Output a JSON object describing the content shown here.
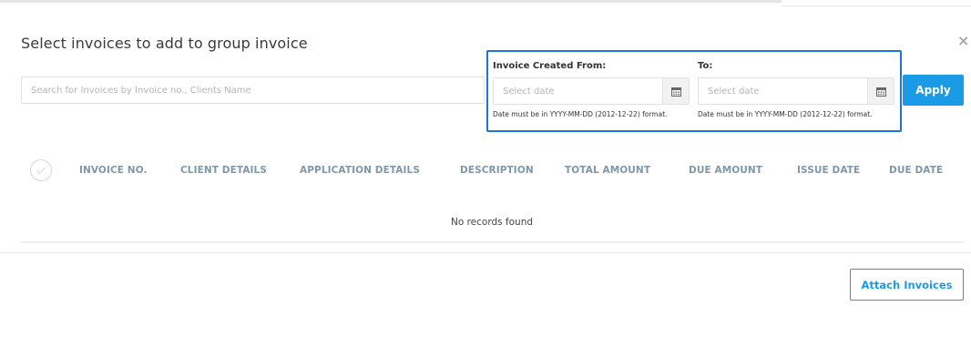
{
  "modal": {
    "title": "Select invoices to add to group invoice",
    "close_symbol": "×"
  },
  "search": {
    "placeholder": "Search for Invoices by Invoice no., Clients Name",
    "value": ""
  },
  "filters": {
    "from_label": "Invoice Created From:",
    "to_label": "To:",
    "from_placeholder": "Select date",
    "to_placeholder": "Select date",
    "hint": "Date must be in YYYY-MM-DD (2012-12-22) format.",
    "highlight_color": "#1a73e8"
  },
  "apply_label": "Apply",
  "table": {
    "columns": [
      "INVOICE NO.",
      "CLIENT DETAILS",
      "APPLICATION DETAILS",
      "DESCRIPTION",
      "TOTAL AMOUNT",
      "DUE AMOUNT",
      "ISSUE DATE",
      "DUE DATE"
    ],
    "empty_message": "No records found"
  },
  "footer": {
    "attach_label": "Attach Invoices"
  },
  "colors": {
    "accent": "#1a9be6",
    "header_text": "#7f97aa"
  }
}
